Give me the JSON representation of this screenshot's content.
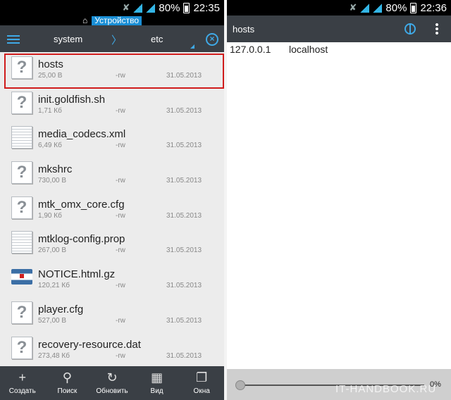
{
  "left": {
    "status": {
      "battery": "80%",
      "time": "22:35"
    },
    "device_label": "Устройство",
    "breadcrumb": {
      "items": [
        "system",
        "etc"
      ],
      "separator": "〉"
    },
    "files": [
      {
        "name": "hosts",
        "size": "25,00 B",
        "perm": "-rw",
        "date": "31.05.2013",
        "icon": "unknown-file-icon"
      },
      {
        "name": "init.goldfish.sh",
        "size": "1,71 Кб",
        "perm": "-rw",
        "date": "31.05.2013",
        "icon": "unknown-file-icon"
      },
      {
        "name": "media_codecs.xml",
        "size": "6,49 Кб",
        "perm": "-rw",
        "date": "31.05.2013",
        "icon": "text-file-icon"
      },
      {
        "name": "mkshrc",
        "size": "730,00 B",
        "perm": "-rw",
        "date": "31.05.2013",
        "icon": "unknown-file-icon"
      },
      {
        "name": "mtk_omx_core.cfg",
        "size": "1,90 Кб",
        "perm": "-rw",
        "date": "31.05.2013",
        "icon": "unknown-file-icon"
      },
      {
        "name": "mtklog-config.prop",
        "size": "267,00 B",
        "perm": "-rw",
        "date": "31.05.2013",
        "icon": "text-file-icon"
      },
      {
        "name": "NOTICE.html.gz",
        "size": "120,21 Кб",
        "perm": "-rw",
        "date": "31.05.2013",
        "icon": "archive-file-icon"
      },
      {
        "name": "player.cfg",
        "size": "527,00 B",
        "perm": "-rw",
        "date": "31.05.2013",
        "icon": "unknown-file-icon"
      },
      {
        "name": "recovery-resource.dat",
        "size": "273,48 Кб",
        "perm": "-rw",
        "date": "31.05.2013",
        "icon": "unknown-file-icon"
      }
    ],
    "bottom_buttons": [
      {
        "label": "Создать",
        "icon": "plus-icon"
      },
      {
        "label": "Поиск",
        "icon": "search-icon"
      },
      {
        "label": "Обновить",
        "icon": "refresh-icon"
      },
      {
        "label": "Вид",
        "icon": "grid-icon"
      },
      {
        "label": "Окна",
        "icon": "windows-icon"
      }
    ]
  },
  "right": {
    "status": {
      "battery": "80%",
      "time": "22:36"
    },
    "title": "hosts",
    "content": {
      "ip": "127.0.0.1",
      "host": "localhost"
    },
    "progress_value": 0,
    "progress_label": "0%",
    "watermark": "IT-HANDBOOK.RU"
  },
  "colors": {
    "accent": "#3fa9e6",
    "toolbar": "#3a3f45",
    "highlight": "#d01c1c",
    "device_badge": "#1a8fd6"
  }
}
